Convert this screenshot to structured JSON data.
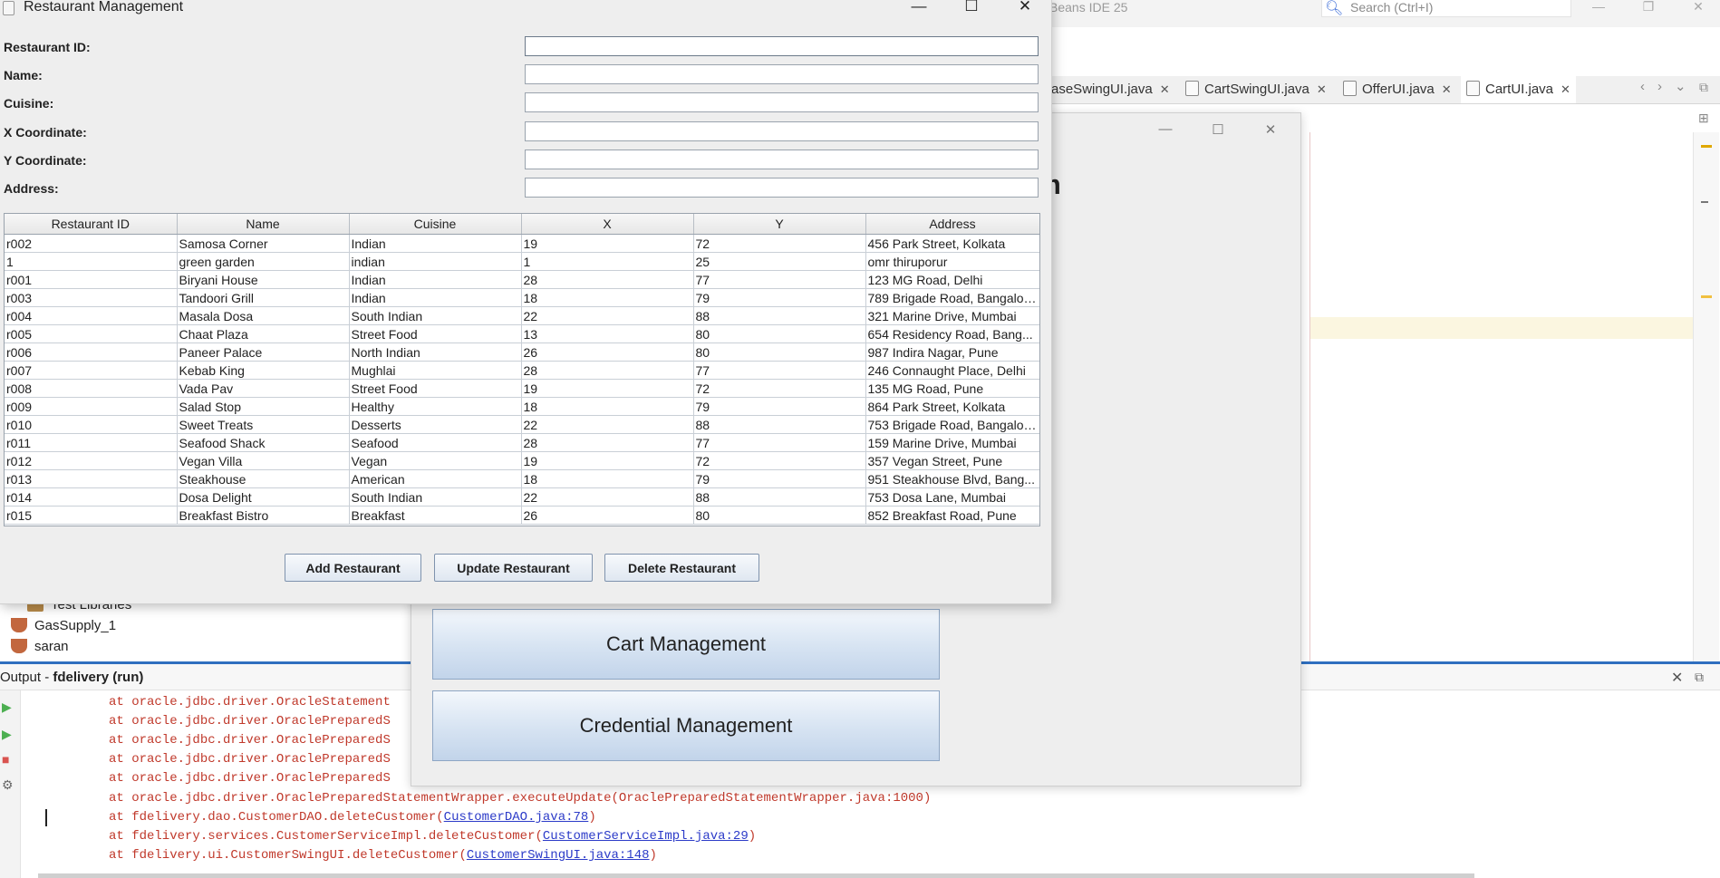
{
  "ide": {
    "title_fragment": "Beans IDE 25",
    "search_placeholder": "Search (Ctrl+I)",
    "tabs": [
      {
        "label": "aseSwingUI.java"
      },
      {
        "label": "CartSwingUI.java"
      },
      {
        "label": "OfferUI.java"
      },
      {
        "label": "CartUI.java"
      }
    ],
    "project_tree": [
      "Test Libraries",
      "GasSupply_1",
      "saran"
    ],
    "output": {
      "prefix": "Output - ",
      "project": "fdelivery (run)",
      "lines": [
        {
          "text": "at oracle.jdbc.driver.OracleStatement",
          "link": "",
          "tail": ""
        },
        {
          "text": "at oracle.jdbc.driver.OraclePreparedS",
          "link": "",
          "tail": ""
        },
        {
          "text": "at oracle.jdbc.driver.OraclePreparedS",
          "link": "",
          "tail": ""
        },
        {
          "text": "at oracle.jdbc.driver.OraclePreparedS",
          "link": "",
          "tail": ""
        },
        {
          "text": "at oracle.jdbc.driver.OraclePreparedS",
          "link": "",
          "tail": ""
        },
        {
          "text": "at oracle.jdbc.driver.OraclePreparedStatementWrapper.executeUpdate(OraclePreparedStatementWrapper.java:1000)",
          "link": "",
          "tail": ""
        },
        {
          "text": "at fdelivery.dao.CustomerDAO.deleteCustomer(",
          "link": "CustomerDAO.java:78",
          "tail": ")"
        },
        {
          "text": "at fdelivery.services.CustomerServiceImpl.deleteCustomer(",
          "link": "CustomerServiceImpl.java:29",
          "tail": ")"
        },
        {
          "text": "at fdelivery.ui.CustomerSwingUI.deleteCustomer(",
          "link": "CustomerSwingUI.java:148",
          "tail": ")"
        }
      ]
    }
  },
  "main_menu": {
    "heading_fragment": "em",
    "buttons": [
      "",
      "",
      "",
      "",
      "",
      "Cart Management",
      "Credential Management"
    ]
  },
  "restaurant_window": {
    "title": "Restaurant Management",
    "fields": {
      "restaurant_id": {
        "label": "Restaurant ID:",
        "value": ""
      },
      "name": {
        "label": "Name:",
        "value": ""
      },
      "cuisine": {
        "label": "Cuisine:",
        "value": ""
      },
      "x": {
        "label": "X Coordinate:",
        "value": ""
      },
      "y": {
        "label": "Y Coordinate:",
        "value": ""
      },
      "address": {
        "label": "Address:",
        "value": ""
      }
    },
    "table": {
      "columns": [
        "Restaurant ID",
        "Name",
        "Cuisine",
        "X",
        "Y",
        "Address"
      ],
      "rows": [
        [
          "r002",
          "Samosa Corner",
          "Indian",
          "19",
          "72",
          "456 Park Street, Kolkata"
        ],
        [
          "1",
          "green garden",
          "indian",
          "1",
          "25",
          "omr thiruporur"
        ],
        [
          "r001",
          "Biryani House",
          "Indian",
          "28",
          "77",
          "123 MG Road, Delhi"
        ],
        [
          "r003",
          "Tandoori Grill",
          "Indian",
          "18",
          "79",
          "789 Brigade Road, Bangalor..."
        ],
        [
          "r004",
          "Masala Dosa",
          "South Indian",
          "22",
          "88",
          "321 Marine Drive, Mumbai"
        ],
        [
          "r005",
          "Chaat Plaza",
          "Street Food",
          "13",
          "80",
          "654 Residency Road, Bang..."
        ],
        [
          "r006",
          "Paneer Palace",
          "North Indian",
          "26",
          "80",
          "987 Indira Nagar, Pune"
        ],
        [
          "r007",
          "Kebab King",
          "Mughlai",
          "28",
          "77",
          "246 Connaught Place, Delhi"
        ],
        [
          "r008",
          "Vada Pav",
          "Street Food",
          "19",
          "72",
          "135 MG Road, Pune"
        ],
        [
          "r009",
          "Salad Stop",
          "Healthy",
          "18",
          "79",
          "864 Park Street, Kolkata"
        ],
        [
          "r010",
          "Sweet Treats",
          "Desserts",
          "22",
          "88",
          "753 Brigade Road, Bangalor..."
        ],
        [
          "r011",
          "Seafood Shack",
          "Seafood",
          "28",
          "77",
          "159 Marine Drive, Mumbai"
        ],
        [
          "r012",
          "Vegan Villa",
          "Vegan",
          "19",
          "72",
          "357 Vegan Street, Pune"
        ],
        [
          "r013",
          "Steakhouse",
          "American",
          "18",
          "79",
          "951 Steakhouse Blvd, Bang..."
        ],
        [
          "r014",
          "Dosa Delight",
          "South Indian",
          "22",
          "88",
          "753 Dosa Lane, Mumbai"
        ],
        [
          "r015",
          "Breakfast Bistro",
          "Breakfast",
          "26",
          "80",
          "852 Breakfast Road, Pune"
        ]
      ]
    },
    "buttons": {
      "add": "Add Restaurant",
      "update": "Update Restaurant",
      "delete": "Delete Restaurant"
    }
  }
}
